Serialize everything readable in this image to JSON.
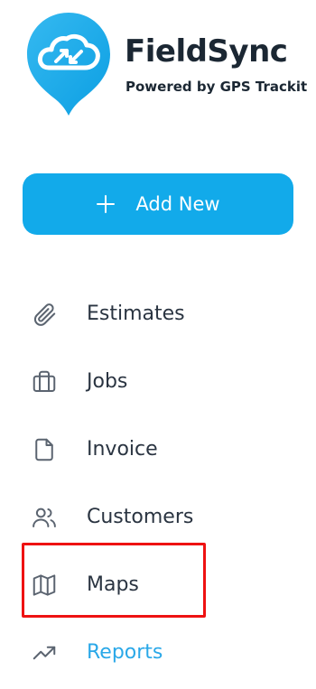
{
  "brand": {
    "name": "FieldSync",
    "tagline": "Powered by GPS Trackit",
    "accent_color": "#12aaea"
  },
  "actions": {
    "add_new_label": "Add New",
    "add_new_icon": "plus-icon"
  },
  "nav": {
    "items": [
      {
        "label": "Estimates",
        "icon": "paperclip-icon"
      },
      {
        "label": "Jobs",
        "icon": "briefcase-icon"
      },
      {
        "label": "Invoice",
        "icon": "document-icon"
      },
      {
        "label": "Customers",
        "icon": "users-icon"
      },
      {
        "label": "Maps",
        "icon": "map-icon",
        "highlighted": true
      },
      {
        "label": "Reports",
        "icon": "trending-up-icon",
        "color": "#2aa8e8"
      }
    ]
  },
  "highlight": {
    "target": "Maps",
    "color": "#ee1212"
  }
}
